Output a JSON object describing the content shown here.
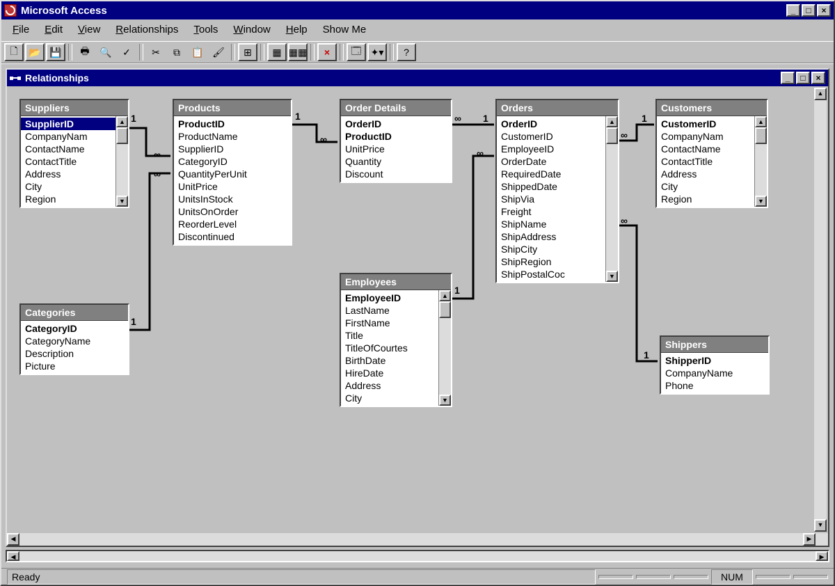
{
  "app": {
    "title": "Microsoft Access"
  },
  "menu": [
    "File",
    "Edit",
    "View",
    "Relationships",
    "Tools",
    "Window",
    "Help",
    "Show Me"
  ],
  "childWindow": {
    "title": "Relationships"
  },
  "status": {
    "text": "Ready",
    "num": "NUM"
  },
  "tables": {
    "suppliers": {
      "title": "Suppliers",
      "fields": [
        "SupplierID",
        "CompanyNam",
        "ContactName",
        "ContactTitle",
        "Address",
        "City",
        "Region"
      ],
      "pk": [
        0
      ],
      "selected": 0,
      "scroll": true
    },
    "products": {
      "title": "Products",
      "fields": [
        "ProductID",
        "ProductName",
        "SupplierID",
        "CategoryID",
        "QuantityPerUnit",
        "UnitPrice",
        "UnitsInStock",
        "UnitsOnOrder",
        "ReorderLevel",
        "Discontinued"
      ],
      "pk": [
        0
      ],
      "scroll": false
    },
    "orderdetails": {
      "title": "Order Details",
      "fields": [
        "OrderID",
        "ProductID",
        "UnitPrice",
        "Quantity",
        "Discount"
      ],
      "pk": [
        0,
        1
      ],
      "scroll": false
    },
    "orders": {
      "title": "Orders",
      "fields": [
        "OrderID",
        "CustomerID",
        "EmployeeID",
        "OrderDate",
        "RequiredDate",
        "ShippedDate",
        "ShipVia",
        "Freight",
        "ShipName",
        "ShipAddress",
        "ShipCity",
        "ShipRegion",
        "ShipPostalCoc"
      ],
      "pk": [
        0
      ],
      "scroll": true
    },
    "customers": {
      "title": "Customers",
      "fields": [
        "CustomerID",
        "CompanyNam",
        "ContactName",
        "ContactTitle",
        "Address",
        "City",
        "Region"
      ],
      "pk": [
        0
      ],
      "scroll": true
    },
    "employees": {
      "title": "Employees",
      "fields": [
        "EmployeeID",
        "LastName",
        "FirstName",
        "Title",
        "TitleOfCourtes",
        "BirthDate",
        "HireDate",
        "Address",
        "City"
      ],
      "pk": [
        0
      ],
      "scroll": true
    },
    "categories": {
      "title": "Categories",
      "fields": [
        "CategoryID",
        "CategoryName",
        "Description",
        "Picture"
      ],
      "pk": [
        0
      ],
      "scroll": false
    },
    "shippers": {
      "title": "Shippers",
      "fields": [
        "ShipperID",
        "CompanyName",
        "Phone"
      ],
      "pk": [
        0
      ],
      "scroll": false
    }
  },
  "relLabels": {
    "l1a": "1",
    "l1b": "∞",
    "l2a": "∞",
    "l2b": "1",
    "l3a": "1",
    "l3b": "∞",
    "l4a": "∞",
    "l4b": "1",
    "l5a": "1",
    "l5b": "∞",
    "l6a": "1",
    "l6b": "∞",
    "l7a": "∞",
    "l7b": "1"
  }
}
